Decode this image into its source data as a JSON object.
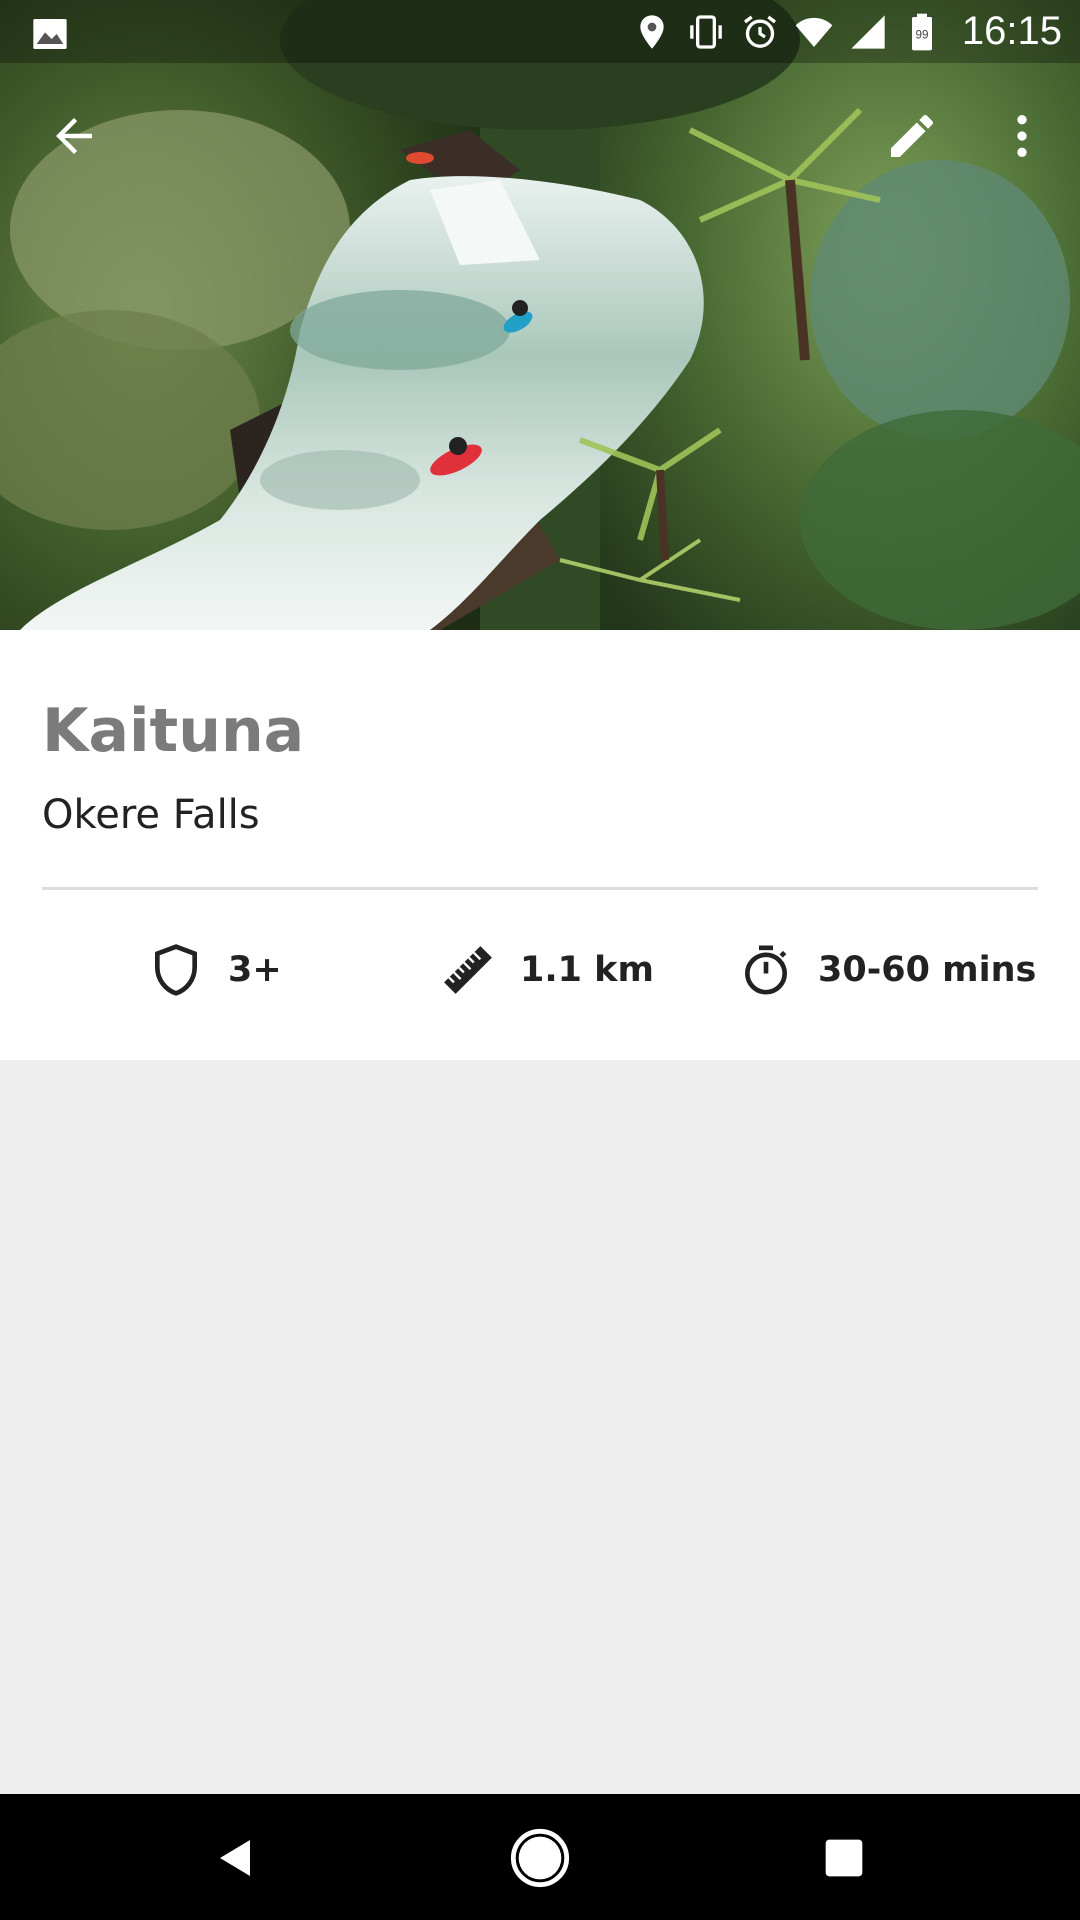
{
  "status_bar": {
    "time": "16:15",
    "battery_level": "99",
    "icons": [
      "image-icon",
      "location-icon",
      "vibrate-icon",
      "alarm-icon",
      "wifi-icon",
      "signal-icon",
      "battery-icon"
    ]
  },
  "toolbar": {
    "back_icon": "arrow-back-icon",
    "edit_icon": "pencil-icon",
    "more_icon": "more-vert-icon"
  },
  "river": {
    "name": "Kaituna",
    "section": "Okere Falls"
  },
  "stats": {
    "grade": {
      "icon": "shield-icon",
      "value": "3+"
    },
    "length": {
      "icon": "ruler-icon",
      "value": "1.1 km"
    },
    "duration": {
      "icon": "stopwatch-icon",
      "value": "30-60 mins"
    }
  },
  "nav_bar": {
    "icons": [
      "nav-back-icon",
      "nav-home-icon",
      "nav-recent-icon"
    ]
  },
  "colors": {
    "title_gray": "#7b7b7b",
    "text_dark": "#222222",
    "card_bg": "#ffffff",
    "page_bg": "#eeeeee",
    "divider": "#dddddd"
  }
}
